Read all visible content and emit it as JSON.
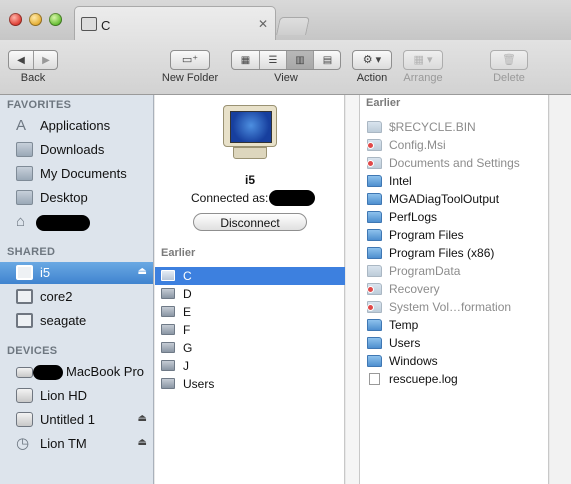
{
  "window": {
    "tab_title": "C"
  },
  "toolbar": {
    "back_label": "Back",
    "new_folder_label": "New Folder",
    "view_label": "View",
    "action_label": "Action",
    "arrange_label": "Arrange",
    "delete_label": "Delete"
  },
  "sidebar": {
    "favorites_heading": "FAVORITES",
    "favorites": [
      {
        "label": "Applications",
        "icon": "applications-icon"
      },
      {
        "label": "Downloads",
        "icon": "folder-icon"
      },
      {
        "label": "My Documents",
        "icon": "folder-icon"
      },
      {
        "label": "Desktop",
        "icon": "folder-icon"
      },
      {
        "label": "",
        "icon": "home-icon"
      }
    ],
    "shared_heading": "SHARED",
    "shared": [
      {
        "label": "i5",
        "icon": "screen-icon",
        "selected": true,
        "eject": true
      },
      {
        "label": "core2",
        "icon": "screen-icon"
      },
      {
        "label": "seagate",
        "icon": "screen-icon"
      }
    ],
    "devices_heading": "DEVICES",
    "devices": [
      {
        "label": "MacBook Pro",
        "icon": "laptop-icon"
      },
      {
        "label": "Lion HD",
        "icon": "disk-icon"
      },
      {
        "label": "Untitled 1",
        "icon": "disk-icon",
        "eject": true
      },
      {
        "label": "Lion TM",
        "icon": "time-machine-icon",
        "eject": true
      }
    ]
  },
  "server": {
    "name": "i5",
    "connected_as": "Connected as:",
    "disconnect_label": "Disconnect",
    "section_heading": "Earlier",
    "shares": [
      "C",
      "D",
      "E",
      "F",
      "G",
      "J",
      "Users"
    ],
    "selected_share": "C"
  },
  "contents": {
    "section_heading": "Earlier",
    "items": [
      {
        "name": "$RECYCLE.BIN",
        "type": "folder",
        "dim": true
      },
      {
        "name": "Config.Msi",
        "type": "folder",
        "dim": true,
        "badge": true
      },
      {
        "name": "Documents and Settings",
        "type": "folder",
        "dim": true,
        "badge": true
      },
      {
        "name": "Intel",
        "type": "folder"
      },
      {
        "name": "MGADiagToolOutput",
        "type": "folder"
      },
      {
        "name": "PerfLogs",
        "type": "folder"
      },
      {
        "name": "Program Files",
        "type": "folder"
      },
      {
        "name": "Program Files (x86)",
        "type": "folder"
      },
      {
        "name": "ProgramData",
        "type": "folder",
        "dim": true
      },
      {
        "name": "Recovery",
        "type": "folder",
        "dim": true,
        "badge": true
      },
      {
        "name": "System Vol…formation",
        "type": "folder",
        "dim": true,
        "badge": true
      },
      {
        "name": "Temp",
        "type": "folder"
      },
      {
        "name": "Users",
        "type": "folder"
      },
      {
        "name": "Windows",
        "type": "folder"
      },
      {
        "name": "rescuepe.log",
        "type": "file"
      }
    ]
  },
  "colors": {
    "selection": "#3d80df",
    "sidebar_bg": "#dde4ec",
    "folder_blue": "#4e8fcf"
  }
}
